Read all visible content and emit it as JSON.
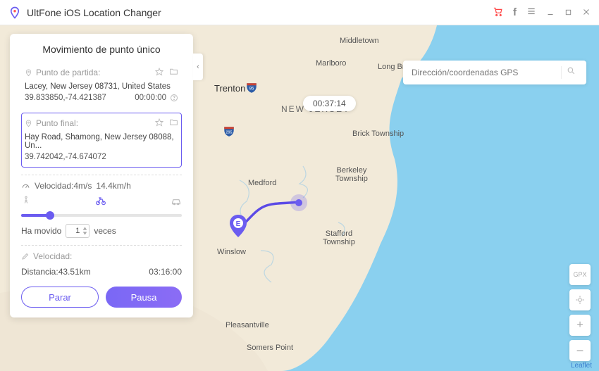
{
  "title_bar": {
    "app_name": "UltFone iOS Location Changer"
  },
  "panel": {
    "title": "Movimiento de punto único",
    "start": {
      "label": "Punto de partida:",
      "address": "Lacey, New Jersey 08731, United States",
      "coords": "39.833850,-74.421387",
      "time": "00:00:00"
    },
    "end": {
      "label": "Punto final:",
      "address": "Hay Road, Shamong, New Jersey 08088, Un...",
      "coords": "39.742042,-74.674072"
    },
    "speed_label": "Velocidad:4m/s",
    "speed_alt": "14.4km/h",
    "moved_label_pre": "Ha movido",
    "moved_count": "1",
    "moved_label_post": "veces",
    "velocity_label": "Velocidad:",
    "distance_label": "Distancia:43.51km",
    "distance_time": "03:16:00",
    "btn_stop": "Parar",
    "btn_pause": "Pausa"
  },
  "search": {
    "placeholder": "Dirección/coordenadas GPS"
  },
  "timer": {
    "elapsed": "00:37:14"
  },
  "map": {
    "labels": {
      "middletown": "Middletown",
      "marlboro": "Marlboro",
      "longbranch": "Long Branch",
      "trenton": "Trenton",
      "newjersey": "NEW JERSEY",
      "bricktown": "Brick Township",
      "berkeley": "Berkeley\nTownship",
      "medford": "Medford",
      "stafford": "Stafford\nTownship",
      "winslow": "Winslow",
      "pleasantville": "Pleasantville",
      "somerspt": "Somers Point"
    },
    "end_letter": "E",
    "attribution": "Leaflet",
    "gpx": "GPX"
  }
}
